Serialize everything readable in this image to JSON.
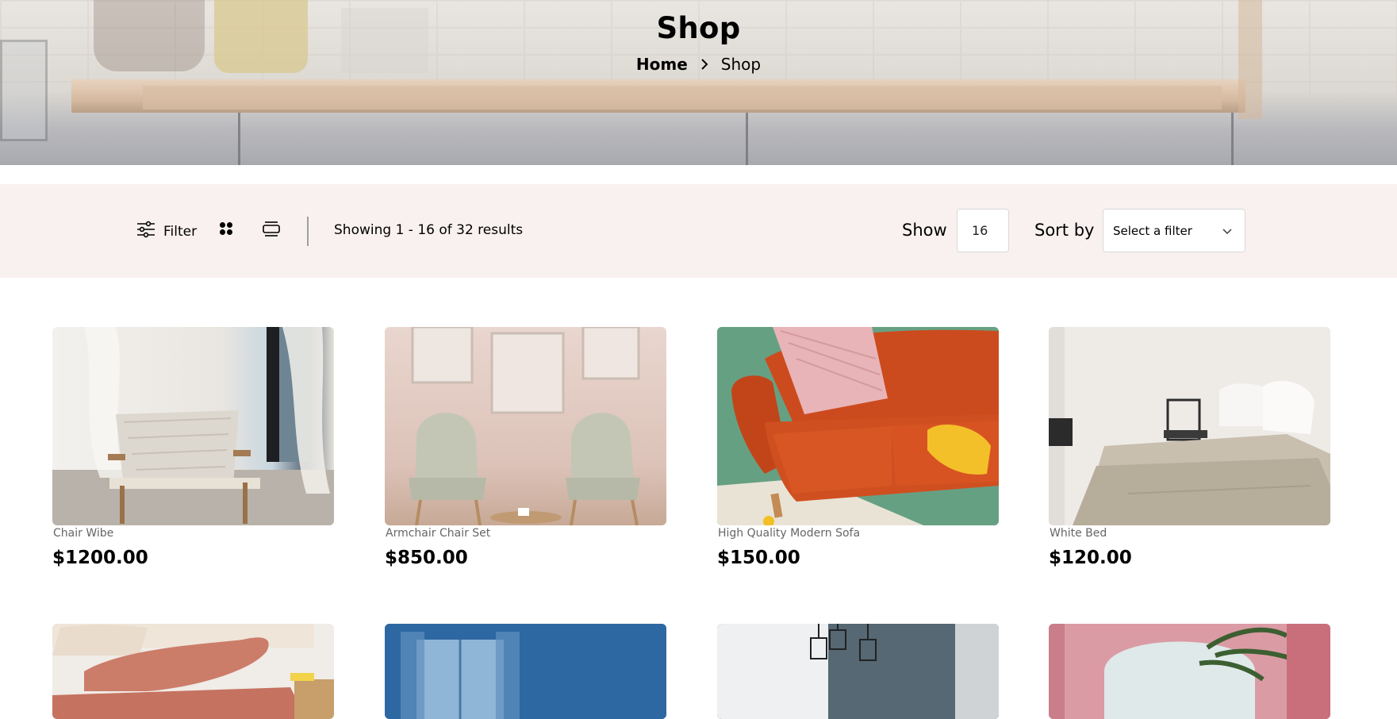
{
  "hero": {
    "title": "Shop",
    "breadcrumb": {
      "home": "Home",
      "current": "Shop"
    }
  },
  "toolbar": {
    "filter_label": "Filter",
    "showing_text": "Showing 1 - 16 of 32 results",
    "show_label": "Show",
    "show_value": "16",
    "sort_label": "Sort by",
    "sort_selected": "Select a filter"
  },
  "products": [
    {
      "name": "Chair Wibe",
      "price": "$1200.00"
    },
    {
      "name": "Armchair Chair Set",
      "price": "$850.00"
    },
    {
      "name": "High Quality Modern Sofa",
      "price": "$150.00"
    },
    {
      "name": "White Bed",
      "price": "$120.00"
    }
  ],
  "colors": {
    "filter_bar_bg": "#f9f1f0",
    "text": "#000000",
    "muted_text": "#666666"
  }
}
